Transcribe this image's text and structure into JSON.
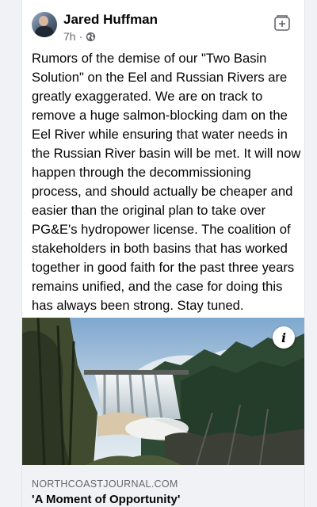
{
  "post": {
    "author": "Jared Huffman",
    "time": "7h",
    "separator": "·",
    "privacy_icon": "globe-icon",
    "action_icon": "bookmark-save-icon",
    "text": "Rumors of the demise of our \"Two Basin Solution\" on the Eel and Russian Rivers are greatly exaggerated.  We are on track to remove a huge salmon-blocking dam on the Eel River while ensuring that water needs in the Russian River basin will be met.  It will now happen through the decommissioning process, and should actually be cheaper and easier than the original plan to take over PG&E's hydropower license.  The coalition of stakeholders in both basins that has worked together in good faith for the past three years remains unified, and the case for doing this has always been strong.  Stay tuned."
  },
  "link_preview": {
    "info_label": "i",
    "domain": "NORTHCOASTJOURNAL.COM",
    "title": "'A Moment of Opportunity'"
  },
  "colors": {
    "card_background": "#ffffff",
    "page_background": "#f0f2f5",
    "primary_text": "#050505",
    "secondary_text": "#65676b"
  }
}
